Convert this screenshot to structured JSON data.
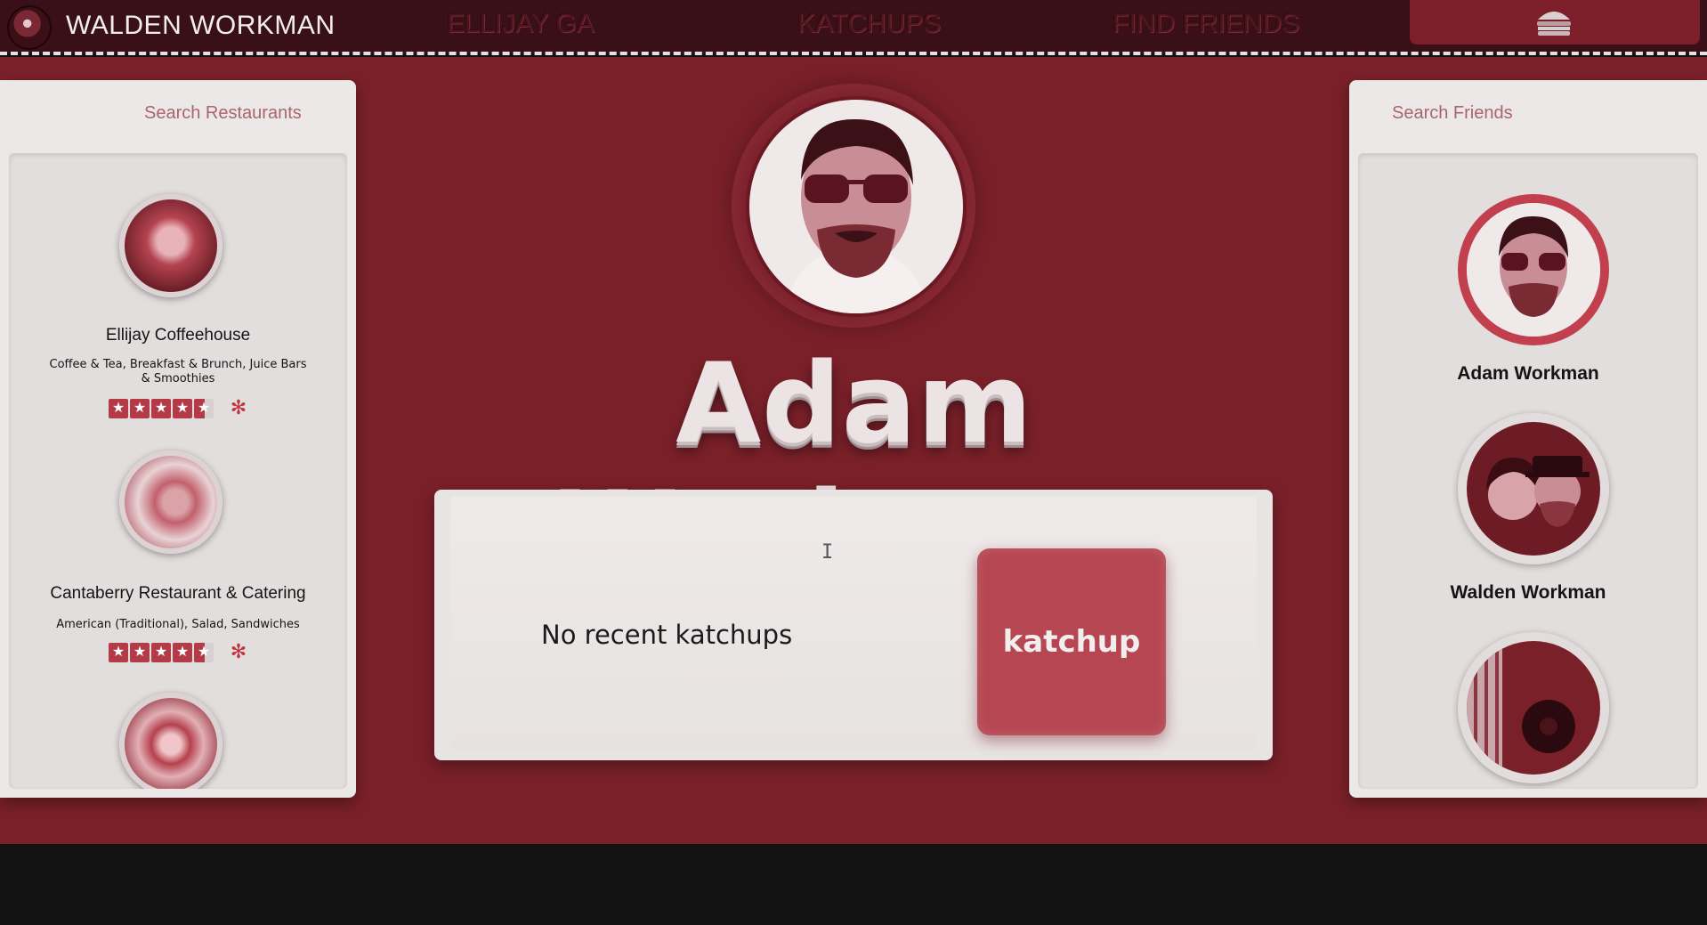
{
  "topbar": {
    "brand_name": "WALDEN WORKMAN",
    "nav": [
      "ELLIJAY GA",
      "KATCHUPS",
      "FIND FRIENDS"
    ]
  },
  "restaurants": {
    "search_placeholder": "Search Restaurants",
    "items": [
      {
        "name": "Ellijay Coffeehouse",
        "categories": "Coffee & Tea, Breakfast & Brunch, Juice Bars & Smoothies",
        "rating": 4.5
      },
      {
        "name": "Cantaberry Restaurant & Catering",
        "categories": "American (Traditional), Salad, Sandwiches",
        "rating": 4.5
      }
    ]
  },
  "profile": {
    "name": "Adam Workman",
    "empty_message": "No recent katchups",
    "katchup_button": "katchup"
  },
  "friends": {
    "search_placeholder": "Search Friends",
    "items": [
      {
        "name": "Adam Workman"
      },
      {
        "name": "Walden Workman"
      }
    ]
  },
  "colors": {
    "brand_red": "#7a2029",
    "accent": "#b54652",
    "topbar": "#3a1018"
  }
}
